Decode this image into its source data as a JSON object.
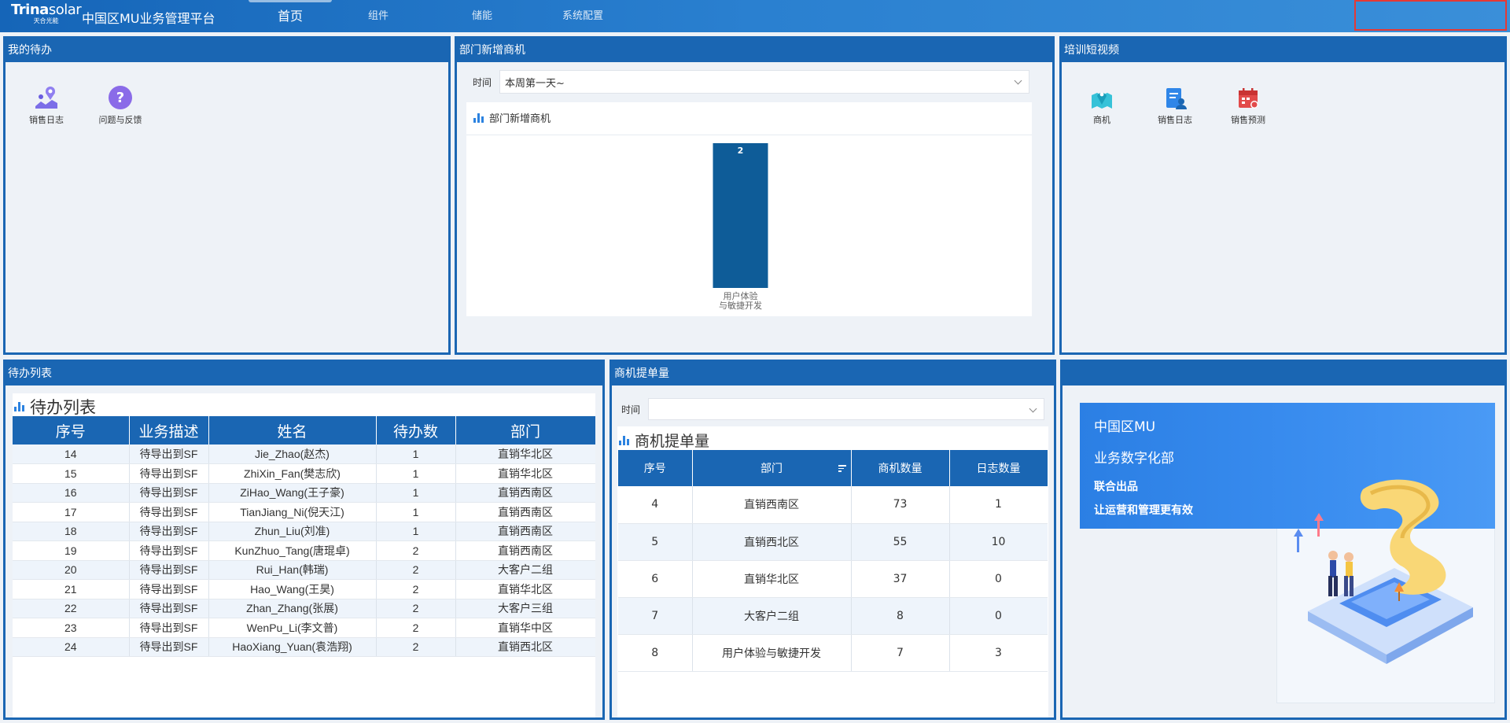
{
  "header": {
    "logo_brand_a": "Trina",
    "logo_brand_b": "solar",
    "logo_sub": "天合光能",
    "app_title": "中国区MU业务管理平台",
    "nav": [
      {
        "label": "首页",
        "active": true
      },
      {
        "label": "组件",
        "active": false
      },
      {
        "label": "储能",
        "active": false
      },
      {
        "label": "系统配置",
        "active": false
      }
    ]
  },
  "todo_panel": {
    "title": "我的待办",
    "items": [
      {
        "label": "销售日志",
        "icon": "map-pin-user-icon"
      },
      {
        "label": "问题与反馈",
        "icon": "question-icon"
      }
    ]
  },
  "opportunity_panel": {
    "title": "部门新增商机",
    "filter_label": "时间",
    "filter_value": "本周第一天~",
    "card_title": "部门新增商机"
  },
  "training_panel": {
    "title": "培训短视频",
    "items": [
      {
        "label": "商机",
        "icon": "map-pin-icon"
      },
      {
        "label": "销售日志",
        "icon": "document-user-icon"
      },
      {
        "label": "销售预测",
        "icon": "calendar-icon"
      }
    ]
  },
  "todo_list": {
    "title": "待办列表",
    "card_title": "待办列表",
    "columns": [
      "序号",
      "业务描述",
      "姓名",
      "待办数",
      "部门"
    ],
    "rows": [
      [
        "14",
        "待导出到SF",
        "Jie_Zhao(赵杰)",
        "1",
        "直销华北区"
      ],
      [
        "15",
        "待导出到SF",
        "ZhiXin_Fan(樊志欣)",
        "1",
        "直销华北区"
      ],
      [
        "16",
        "待导出到SF",
        "ZiHao_Wang(王子豪)",
        "1",
        "直销西南区"
      ],
      [
        "17",
        "待导出到SF",
        "TianJiang_Ni(倪天江)",
        "1",
        "直销西南区"
      ],
      [
        "18",
        "待导出到SF",
        "Zhun_Liu(刘准)",
        "1",
        "直销西南区"
      ],
      [
        "19",
        "待导出到SF",
        "KunZhuo_Tang(唐琨卓)",
        "2",
        "直销西南区"
      ],
      [
        "20",
        "待导出到SF",
        "Rui_Han(韩瑞)",
        "2",
        "大客户二组"
      ],
      [
        "21",
        "待导出到SF",
        "Hao_Wang(王昊)",
        "2",
        "直销华北区"
      ],
      [
        "22",
        "待导出到SF",
        "Zhan_Zhang(张展)",
        "2",
        "大客户三组"
      ],
      [
        "23",
        "待导出到SF",
        "WenPu_Li(李文普)",
        "2",
        "直销华中区"
      ],
      [
        "24",
        "待导出到SF",
        "HaoXiang_Yuan(袁浩翔)",
        "2",
        "直销西北区"
      ]
    ]
  },
  "order_panel": {
    "title": "商机提单量",
    "filter_label": "时间",
    "filter_value": "",
    "card_title": "商机提单量",
    "columns": [
      "序号",
      "部门",
      "商机数量",
      "日志数量"
    ],
    "rows": [
      [
        "4",
        "直销西南区",
        "73",
        "1"
      ],
      [
        "5",
        "直销西北区",
        "55",
        "10"
      ],
      [
        "6",
        "直销华北区",
        "37",
        "0"
      ],
      [
        "7",
        "大客户二组",
        "8",
        "0"
      ],
      [
        "8",
        "用户体验与敏捷开发",
        "7",
        "3"
      ]
    ]
  },
  "promo": {
    "line1": "中国区MU",
    "line2": "业务数字化部",
    "line3": "联合出品",
    "line4": "让运营和管理更有效"
  },
  "colors": {
    "header_blue": "#1a66b3",
    "bar_blue": "#0e5c98",
    "alert_red": "#e53935"
  },
  "chart_data": {
    "type": "bar",
    "title": "部门新增商机",
    "categories": [
      "用户体验与敏捷开发"
    ],
    "values": [
      2
    ],
    "ylim": [
      0,
      2
    ],
    "grid": false
  }
}
